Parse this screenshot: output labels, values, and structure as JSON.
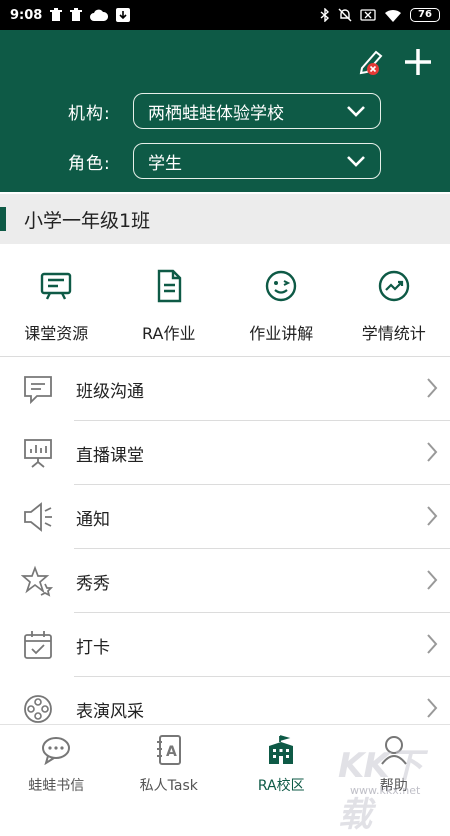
{
  "status_bar": {
    "time": "9:08",
    "battery": "76"
  },
  "header": {
    "org_label": "机构:",
    "org_value": "两栖蛙蛙体验学校",
    "role_label": "角色:",
    "role_value": "学生"
  },
  "class_bar": {
    "title": "小学一年级1班"
  },
  "quick_actions": [
    {
      "label": "课堂资源",
      "icon": "presentation-board-icon"
    },
    {
      "label": "RA作业",
      "icon": "document-icon"
    },
    {
      "label": "作业讲解",
      "icon": "wink-face-icon"
    },
    {
      "label": "学情统计",
      "icon": "trend-chart-icon"
    }
  ],
  "menu": [
    {
      "label": "班级沟通",
      "icon": "chat-bubble-icon"
    },
    {
      "label": "直播课堂",
      "icon": "live-board-icon"
    },
    {
      "label": "通知",
      "icon": "speaker-icon"
    },
    {
      "label": "秀秀",
      "icon": "stars-icon"
    },
    {
      "label": "打卡",
      "icon": "calendar-check-icon"
    },
    {
      "label": "表演风采",
      "icon": "film-reel-icon"
    }
  ],
  "tabs": [
    {
      "label": "蛙蛙书信",
      "icon": "chat-icon"
    },
    {
      "label": "私人Task",
      "icon": "notebook-icon"
    },
    {
      "label": "RA校区",
      "icon": "school-icon"
    },
    {
      "label": "帮助",
      "icon": "help-icon"
    }
  ],
  "watermark": {
    "text": "KK下载",
    "url": "www.kkx.net"
  },
  "colors": {
    "brand": "#0e5a46",
    "divider": "#dcdcdc",
    "class_bar_bg": "#ececec"
  }
}
